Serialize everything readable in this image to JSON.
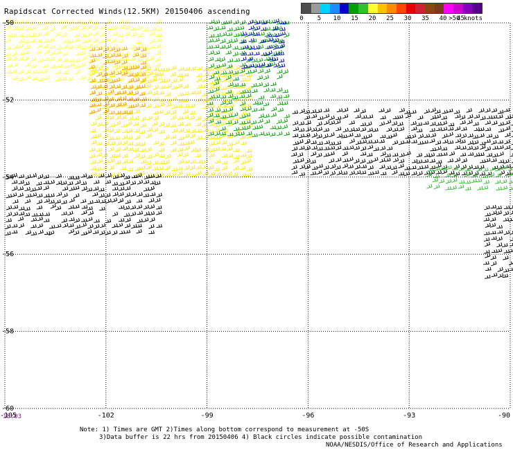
{
  "title": "Rapidscat Corrected Winds(12.5KM) 20150406 ascending",
  "legend": {
    "colors": [
      "#4d4d4d",
      "#9a9a9a",
      "#00d2ff",
      "#1c8cff",
      "#0000cc",
      "#00a000",
      "#2ec02e",
      "#ffff33",
      "#ffc000",
      "#ff8c00",
      "#ff4500",
      "#e60000",
      "#cc2233",
      "#8b4513",
      "#7a3b1a",
      "#ff00ff",
      "#cc00cc",
      "#8800bb",
      "#5a0090"
    ],
    "labels": [
      "0",
      "5",
      "10",
      "15",
      "20",
      "25",
      "30",
      "35",
      "40",
      "45",
      ">50 knots"
    ]
  },
  "axes": {
    "lon_ticks": [
      "-105",
      "-102",
      "-99",
      "-96",
      "-93",
      "-90"
    ],
    "lat_ticks": [
      "-50",
      "-52",
      "-54",
      "-56",
      "-58",
      "-60"
    ],
    "lon_range": [
      -105,
      -90
    ],
    "lat_range": [
      -50,
      -60
    ],
    "grid": true
  },
  "timestamp": "18:03",
  "notes": {
    "line1": "Note: 1) Times are GMT 2)Times along bottom correspond to measurement at -50S",
    "line2": "3)Data buffer is 22 hrs from 20150406 4) Black circles indicate possible contamination"
  },
  "credit": "NOAA/NESDIS/Office of Research and Applications",
  "wind_barbs": {
    "regions": [
      {
        "name": "west-yellow",
        "lon": [
          -105,
          -100.5
        ],
        "lat": [
          -50.0,
          -51.5
        ],
        "color": "#ffff33"
      },
      {
        "name": "central-yellow",
        "lon": [
          -102.5,
          -97.8
        ],
        "lat": [
          -51.2,
          -54.0
        ],
        "color": "#ffe600"
      },
      {
        "name": "orange-patch",
        "lon": [
          -102.5,
          -101.0
        ],
        "lat": [
          -50.7,
          -52.4
        ],
        "color": "#ff9a00"
      },
      {
        "name": "green-band",
        "lon": [
          -99.0,
          -96.6
        ],
        "lat": [
          -50.0,
          -53.0
        ],
        "color": "#00a000"
      },
      {
        "name": "blue-patch",
        "lon": [
          -98.0,
          -96.8
        ],
        "lat": [
          -50.0,
          -51.2
        ],
        "color": "#0000cc"
      },
      {
        "name": "black-southwest",
        "lon": [
          -105,
          -100.5
        ],
        "lat": [
          -54.0,
          -55.6
        ],
        "color": "#000000"
      },
      {
        "name": "black-east-band",
        "lon": [
          -96.5,
          -90.0
        ],
        "lat": [
          -52.3,
          -54.0
        ],
        "color": "#000000"
      },
      {
        "name": "green-east",
        "lon": [
          -92.5,
          -90.0
        ],
        "lat": [
          -53.8,
          -54.4
        ],
        "color": "#2ec02e"
      },
      {
        "name": "black-far-east",
        "lon": [
          -90.8,
          -90.0
        ],
        "lat": [
          -54.8,
          -56.7
        ],
        "color": "#000000"
      }
    ]
  }
}
